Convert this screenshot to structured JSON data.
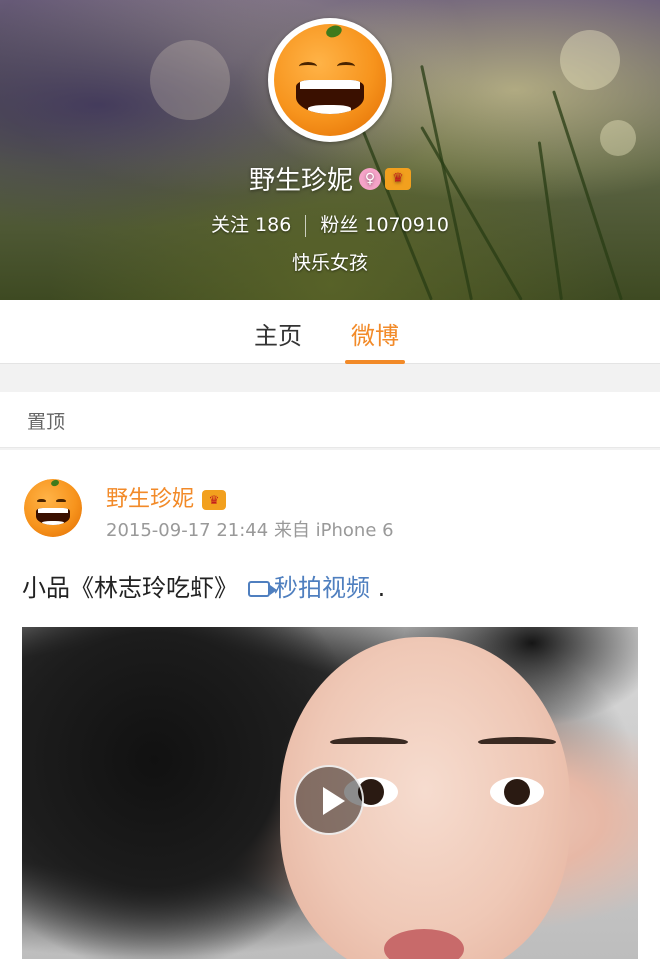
{
  "profile": {
    "name": "野生珍妮",
    "badges": {
      "gender": "female-badge-icon",
      "vip": "vip-crown-icon"
    },
    "stats": {
      "following_label": "关注",
      "following_count": "186",
      "followers_label": "粉丝",
      "followers_count": "1070910"
    },
    "bio": "快乐女孩",
    "avatar_icon": "orange-avatar-icon"
  },
  "tabs": [
    {
      "label": "主页",
      "active": false
    },
    {
      "label": "微博",
      "active": true
    }
  ],
  "pinned_label": "置顶",
  "post": {
    "author": "野生珍妮",
    "timestamp": "2015-09-17 21:44",
    "source": "来自 iPhone 6",
    "text": "小品《林志玲吃虾》",
    "video_link_label": "秒拍视频",
    "text_suffix": ".",
    "video_link_icon": "video-camera-icon",
    "play_icon": "play-icon"
  },
  "colors": {
    "accent": "#f28a28",
    "link": "#4f7fbf",
    "muted": "#999999"
  }
}
